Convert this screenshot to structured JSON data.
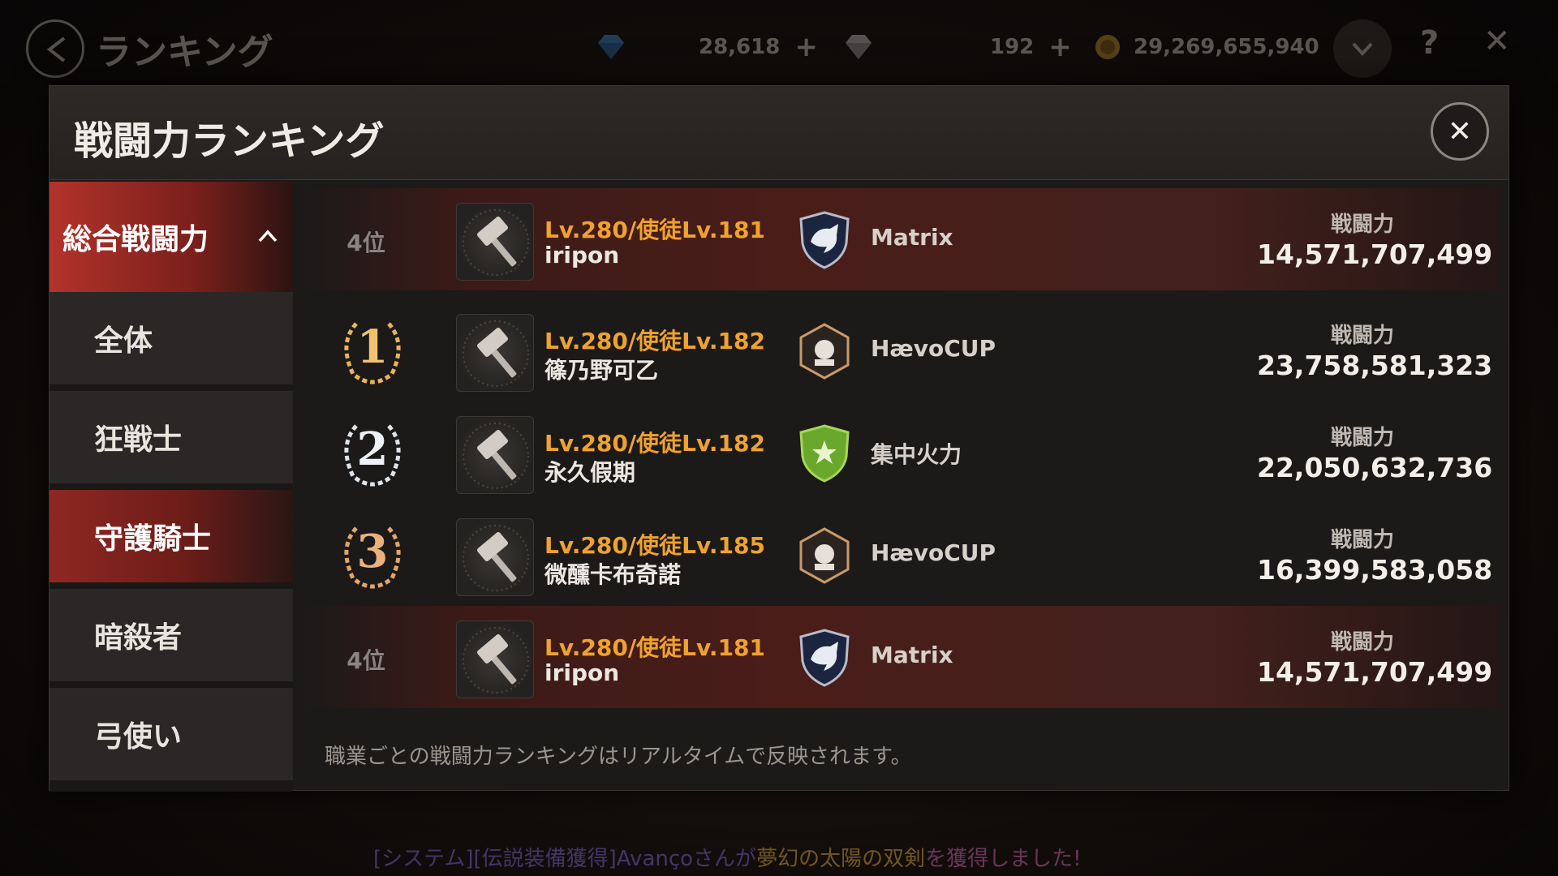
{
  "topbar": {
    "title": "ランキング",
    "gem": "28,618",
    "crystal": "192",
    "gold": "29,269,655,940",
    "plus": "+",
    "help": "?",
    "exit": "✕"
  },
  "modal": {
    "title": "戦闘力ランキング",
    "close": "✕"
  },
  "sidebar": {
    "main_label": "総合戦闘力",
    "items": [
      "全体",
      "狂戦士",
      "守護騎士",
      "暗殺者",
      "弓使い"
    ],
    "active_index": 2
  },
  "rankings": [
    {
      "rank": "4位",
      "level": "Lv.280/使徒Lv.181",
      "name": "iripon",
      "guild": "Matrix",
      "power_label": "戦闘力",
      "power": "14,571,707,499"
    },
    {
      "rank": "1",
      "level": "Lv.280/使徒Lv.182",
      "name": "篠乃野可乙",
      "guild": "HævoCUP",
      "power_label": "戦闘力",
      "power": "23,758,581,323"
    },
    {
      "rank": "2",
      "level": "Lv.280/使徒Lv.182",
      "name": "永久假期",
      "guild": "集中火力",
      "power_label": "戦闘力",
      "power": "22,050,632,736"
    },
    {
      "rank": "3",
      "level": "Lv.280/使徒Lv.185",
      "name": "微醺卡布奇諾",
      "guild": "HævoCUP",
      "power_label": "戦闘力",
      "power": "16,399,583,058"
    },
    {
      "rank": "4位",
      "level": "Lv.280/使徒Lv.181",
      "name": "iripon",
      "guild": "Matrix",
      "power_label": "戦闘力",
      "power": "14,571,707,499"
    }
  ],
  "footnote": "職業ごとの戦闘力ランキングはリアルタイムで反映されます。",
  "system_message": {
    "part1": "[システム][伝説装備獲得]Avançoさんが",
    "item": "夢幻の太陽の双剣",
    "part2": "を獲得しました!"
  },
  "icons": {
    "class_avatar": "hammer-icon",
    "guild_matrix": "wolf-shield-emblem",
    "guild_haevocup": "hexagon-skull-emblem",
    "guild_shuchu": "green-shield-emblem",
    "medal_1": "gold-laurel-medal",
    "medal_2": "silver-laurel-medal",
    "medal_3": "bronze-laurel-medal"
  },
  "colors": {
    "accent_red": "#b3332b",
    "level_orange": "#f0a22e",
    "gold_medal": "#e8b45a",
    "silver_medal": "#e0e4ea",
    "bronze_medal": "#e2a56a"
  }
}
